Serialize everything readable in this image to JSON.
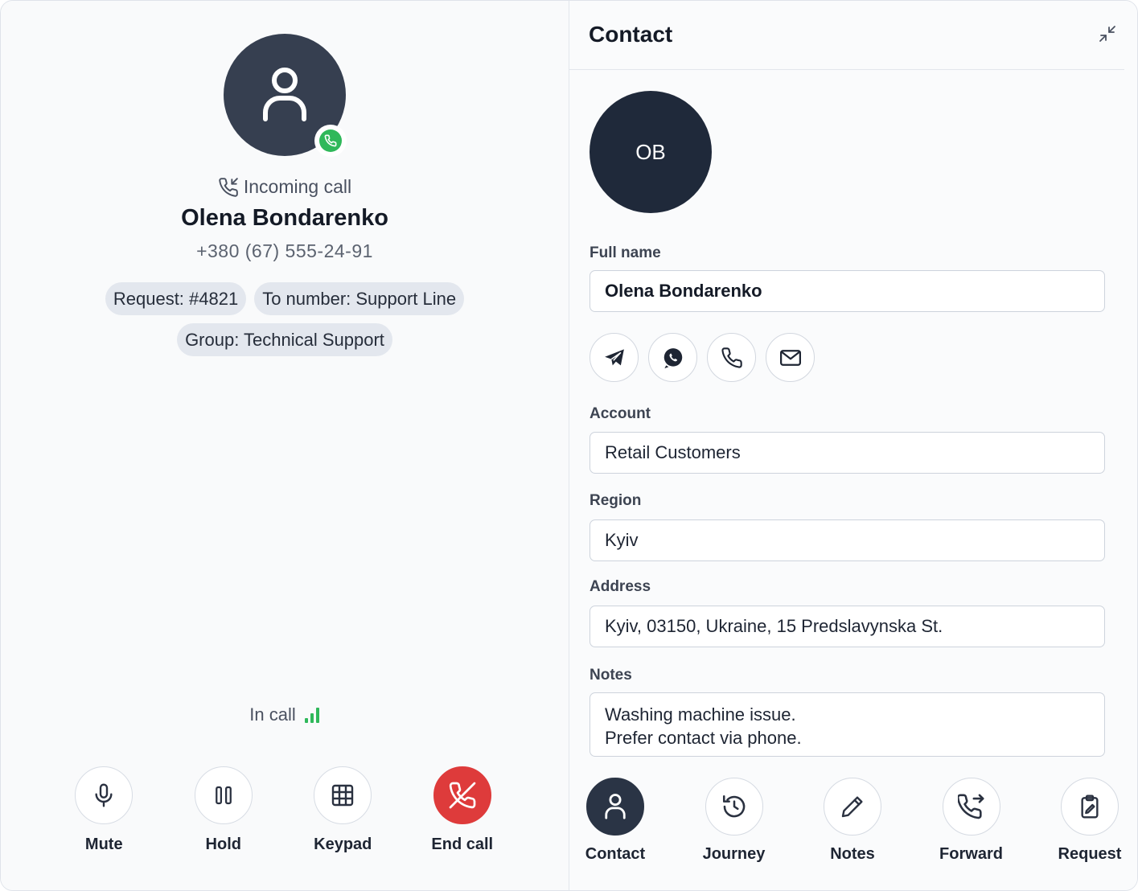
{
  "call": {
    "status": "Incoming call",
    "caller_name": "Olena Bondarenko",
    "caller_phone": "+380 (67) 555-24-91",
    "chips": [
      "Request: #4821",
      "To number: Support Line",
      "Group: Technical Support"
    ],
    "in_call_text": "In call",
    "controls": [
      {
        "label": "Mute",
        "icon": "microphone-icon"
      },
      {
        "label": "Hold",
        "icon": "pause-icon"
      },
      {
        "label": "Keypad",
        "icon": "keypad-icon"
      },
      {
        "label": "End call",
        "icon": "phone-hangup-icon"
      }
    ],
    "colors": {
      "accept": "#2fb85a",
      "end": "#de3b3b",
      "avatar": "#363f50"
    }
  },
  "contact": {
    "title": "Contact",
    "initials": "OB",
    "fields": {
      "full_name": {
        "label": "Full name",
        "value": "Olena Bondarenko"
      },
      "account": {
        "label": "Account",
        "value": "Retail Customers"
      },
      "region": {
        "label": "Region",
        "value": "Kyiv"
      },
      "address": {
        "label": "Address",
        "value": "Kyiv, 03150, Ukraine, 15 Predslavynska St."
      },
      "notes": {
        "label": "Notes",
        "lines": [
          "Washing machine issue.",
          "Prefer contact via phone."
        ]
      }
    },
    "channels": [
      "telegram-icon",
      "whatsapp-icon",
      "phone-icon",
      "mail-icon"
    ],
    "nav": [
      {
        "label": "Contact",
        "icon": "person-icon",
        "active": true
      },
      {
        "label": "Journey",
        "icon": "history-icon",
        "active": false
      },
      {
        "label": "Notes",
        "icon": "pencil-icon",
        "active": false
      },
      {
        "label": "Forward",
        "icon": "phone-forward-icon",
        "active": false
      },
      {
        "label": "Request",
        "icon": "clipboard-icon",
        "active": false
      }
    ]
  }
}
